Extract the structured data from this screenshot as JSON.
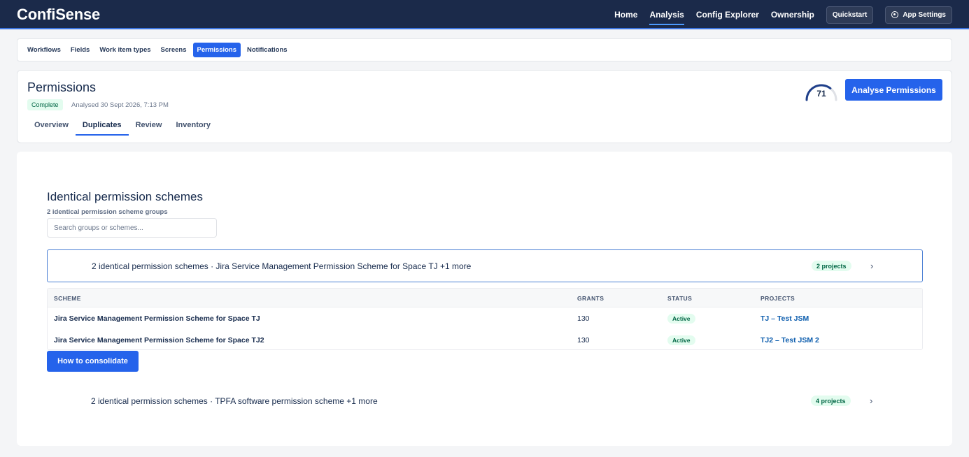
{
  "app": {
    "brand": "ConfiSense",
    "nav": {
      "home": "Home",
      "analysis": "Analysis",
      "config_explorer": "Config Explorer",
      "ownership": "Ownership",
      "quickstart": "Quickstart",
      "app_settings": "App Settings"
    }
  },
  "subnav": {
    "workflows": "Workflows",
    "fields": "Fields",
    "work_item_types": "Work item types",
    "screens": "Screens",
    "permissions": "Permissions",
    "notifications": "Notifications"
  },
  "header": {
    "title": "Permissions",
    "status": "Complete",
    "analysed": "Analysed 30 Sept 2026, 7:13 PM",
    "score": "71",
    "score_value": 71,
    "score_max": 100,
    "analyse_button": "Analyse Permissions",
    "tabs": {
      "overview": "Overview",
      "duplicates": "Duplicates",
      "review": "Review",
      "inventory": "Inventory"
    }
  },
  "section": {
    "title": "Identical permission schemes",
    "subtitle": "2 identical permission scheme groups",
    "search_placeholder": "Search groups or schemes..."
  },
  "groups": [
    {
      "title": "2 identical permission schemes · Jira Service Management Permission Scheme for Space TJ +1 more",
      "projects": "2 projects",
      "expanded": true
    },
    {
      "title": "2 identical permission schemes · TPFA software permission scheme +1 more",
      "projects": "4 projects",
      "expanded": false
    }
  ],
  "table": {
    "headers": {
      "scheme": "SCHEME",
      "grants": "GRANTS",
      "status": "STATUS",
      "projects": "PROJECTS"
    },
    "rows": [
      {
        "scheme": "Jira Service Management Permission Scheme for Space TJ",
        "grants": "130",
        "status": "Active",
        "project": "TJ – Test JSM"
      },
      {
        "scheme": "Jira Service Management Permission Scheme for Space TJ2",
        "grants": "130",
        "status": "Active",
        "project": "TJ2 – Test JSM 2"
      }
    ]
  },
  "consolidate_button": "How to consolidate",
  "icons": {
    "settings": "gear-icon",
    "expand": "chevron-right-icon"
  },
  "colors": {
    "topbar": "#1b2a4a",
    "primary": "#2563eb",
    "success_bg": "#e3fcef",
    "success_text": "#006644",
    "link": "#0b5cad"
  }
}
